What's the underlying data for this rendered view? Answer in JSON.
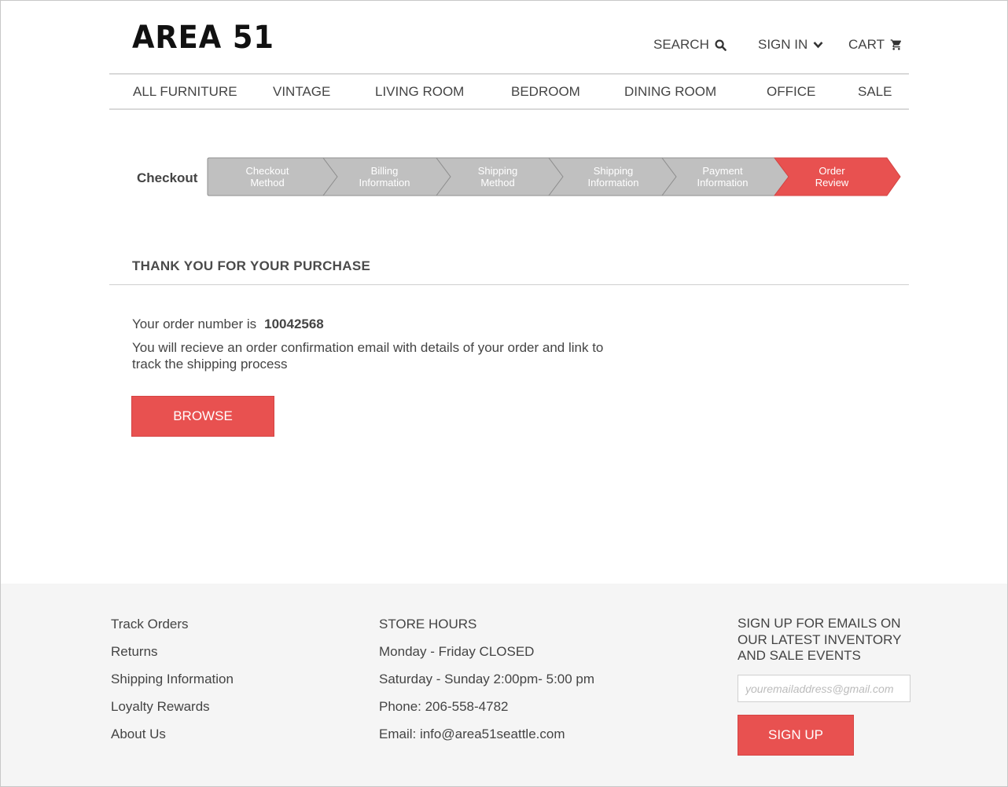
{
  "header": {
    "logo": "AREA 51",
    "search_label": "SEARCH",
    "signin_label": "SIGN IN",
    "cart_label": "CART"
  },
  "nav": {
    "items": [
      {
        "label": "ALL FURNITURE"
      },
      {
        "label": "VINTAGE"
      },
      {
        "label": "LIVING ROOM"
      },
      {
        "label": "BEDROOM"
      },
      {
        "label": "DINING ROOM"
      },
      {
        "label": "OFFICE"
      },
      {
        "label": "SALE"
      }
    ]
  },
  "checkout": {
    "label": "Checkout",
    "steps": [
      {
        "line1": "Checkout",
        "line2": "Method",
        "active": false
      },
      {
        "line1": "Billing",
        "line2": "Information",
        "active": false
      },
      {
        "line1": "Shipping",
        "line2": "Method",
        "active": false
      },
      {
        "line1": "Shipping",
        "line2": "Information",
        "active": false
      },
      {
        "line1": "Payment",
        "line2": "Information",
        "active": false
      },
      {
        "line1": "Order",
        "line2": "Review",
        "active": true
      }
    ],
    "inactive_color": "#c0c0c0",
    "active_color": "#e85150"
  },
  "main": {
    "title": "THANK YOU FOR YOUR PURCHASE",
    "order_prefix": "Your order number is",
    "order_number": "10042568",
    "confirmation": "You will recieve an order confirmation email with details of your order and link to track the shipping process",
    "browse_label": "BROWSE"
  },
  "footer": {
    "links": [
      {
        "label": "Track Orders"
      },
      {
        "label": "Returns"
      },
      {
        "label": "Shipping Information"
      },
      {
        "label": "Loyalty Rewards"
      },
      {
        "label": "About Us"
      }
    ],
    "store": {
      "heading": "STORE HOURS",
      "weekday": "Monday - Friday CLOSED",
      "weekend": "Saturday - Sunday 2:00pm- 5:00 pm",
      "phone": "Phone: 206-558-4782",
      "email": "Email: info@area51seattle.com"
    },
    "signup": {
      "text": "SIGN UP FOR EMAILS ON OUR LATEST INVENTORY AND SALE EVENTS",
      "placeholder": "youremailaddress@gmail.com",
      "button_label": "SIGN UP"
    }
  },
  "colors": {
    "accent": "#e85150",
    "footer_bg": "#f5f5f5"
  }
}
